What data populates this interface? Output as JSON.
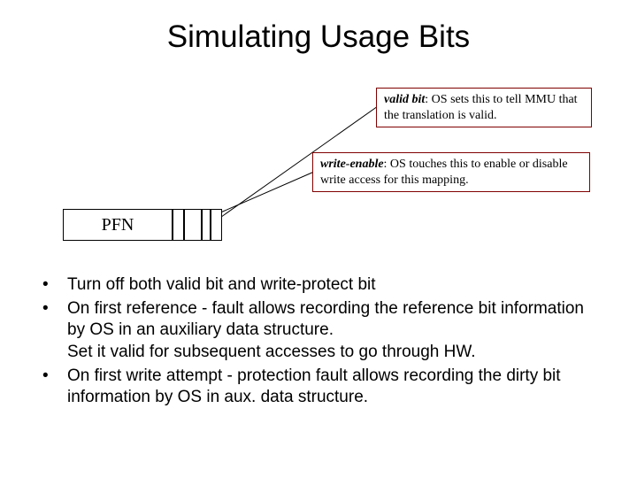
{
  "title": "Simulating Usage Bits",
  "callout_valid": {
    "term": "valid bit",
    "desc": ": OS sets this to tell MMU that the translation is valid."
  },
  "callout_write": {
    "term": "write-enable",
    "desc": ": OS touches this to enable or disable write access for this mapping."
  },
  "pte": {
    "pfn_label": "PFN"
  },
  "bullets": {
    "b1": "Turn off both valid bit and write-protect bit",
    "b2": "On first reference - fault allows recording the reference bit information by OS in an auxiliary data structure.\nSet it valid for subsequent accesses to go through HW.",
    "b3": "On first write attempt - protection fault allows recording the dirty bit information by OS in aux. data structure."
  }
}
